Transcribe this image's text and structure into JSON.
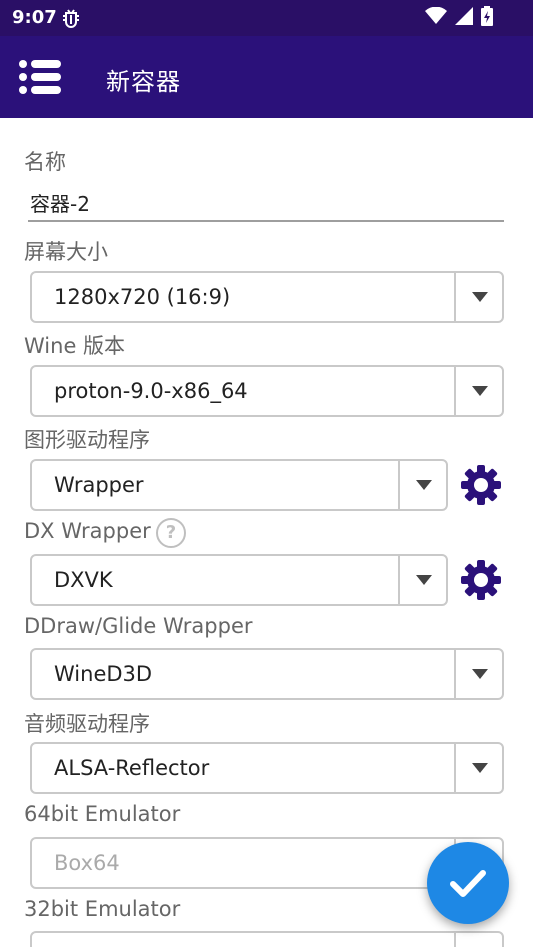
{
  "status_bar": {
    "time": "9:07",
    "left_icon": "bug-icon"
  },
  "app_bar": {
    "title": "新容器",
    "menu_icon": "menu-icon"
  },
  "form": {
    "name": {
      "label": "名称",
      "value": "容器-2"
    },
    "screen_size": {
      "label": "屏幕大小",
      "value": "1280x720 (16:9)"
    },
    "wine_version": {
      "label": "Wine 版本",
      "value": "proton-9.0-x86_64"
    },
    "graphics_driver": {
      "label": "图形驱动程序",
      "value": "Wrapper"
    },
    "dx_wrapper": {
      "label": "DX Wrapper",
      "help": "?",
      "value": "DXVK"
    },
    "ddraw_wrapper": {
      "label": "DDraw/Glide Wrapper",
      "value": "WineD3D"
    },
    "audio_driver": {
      "label": "音频驱动程序",
      "value": "ALSA-Reflector"
    },
    "emulator_64": {
      "label": "64bit Emulator",
      "value": "Box64"
    },
    "emulator_32": {
      "label": "32bit Emulator",
      "value": ""
    }
  },
  "colors": {
    "app_bar": "#2b117a",
    "status_bar": "#2a0f66",
    "fab": "#1e88e5",
    "gear": "#2b117a"
  }
}
